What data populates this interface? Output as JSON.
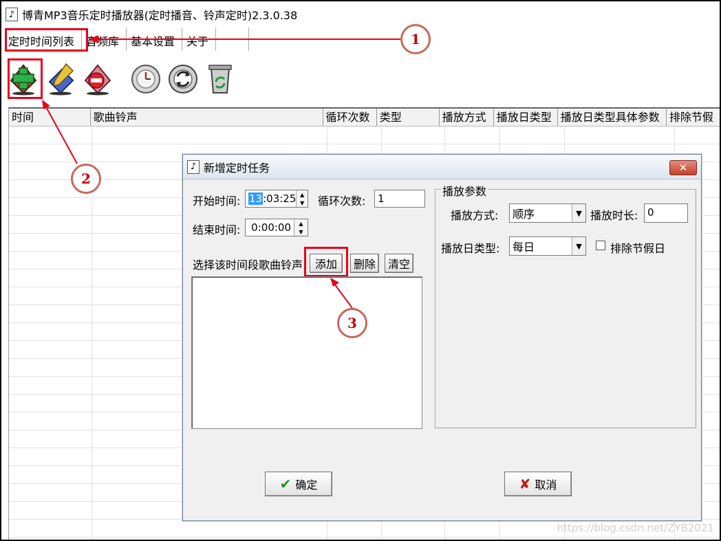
{
  "window": {
    "title": "博青MP3音乐定时播放器(定时播音、铃声定时)2.3.0.38"
  },
  "tabs": [
    {
      "label": "定时时间列表"
    },
    {
      "label": "音频库"
    },
    {
      "label": "基本设置"
    },
    {
      "label": "关于"
    }
  ],
  "toolbar": [
    {
      "name": "add-task-icon"
    },
    {
      "name": "edit-task-icon"
    },
    {
      "name": "delete-task-icon"
    },
    {
      "name": "timer-icon"
    },
    {
      "name": "refresh-icon"
    },
    {
      "name": "recycle-bin-icon"
    }
  ],
  "table": {
    "columns": [
      "时间",
      "歌曲铃声",
      "循环次数",
      "类型",
      "播放方式",
      "播放日类型",
      "播放日类型具体参数",
      "排除节假"
    ]
  },
  "dialog": {
    "title": "新增定时任务",
    "close": "✕",
    "start_label": "开始时间:",
    "start_hour": "13",
    "start_rest": ":03:25",
    "end_label": "结束时间:",
    "end_time": "0:00:00",
    "loop_label": "循环次数:",
    "loop_value": "1",
    "songs_label": "选择该时间段歌曲铃声:",
    "add": "添加",
    "delete": "删除",
    "clear": "清空",
    "group_title": "播放参数",
    "mode_label": "播放方式:",
    "mode_value": "顺序",
    "duration_label": "播放时长:",
    "duration_value": "0",
    "daytype_label": "播放日类型:",
    "daytype_value": "每日",
    "exclude_label": "排除节假日",
    "ok": "确定",
    "cancel": "取消"
  },
  "annotations": [
    "1",
    "2",
    "3"
  ],
  "watermark": "https://blog.csdn.net/ZYB2021",
  "colors": {
    "highlight": "#e8001c",
    "selection": "#3399ff"
  }
}
